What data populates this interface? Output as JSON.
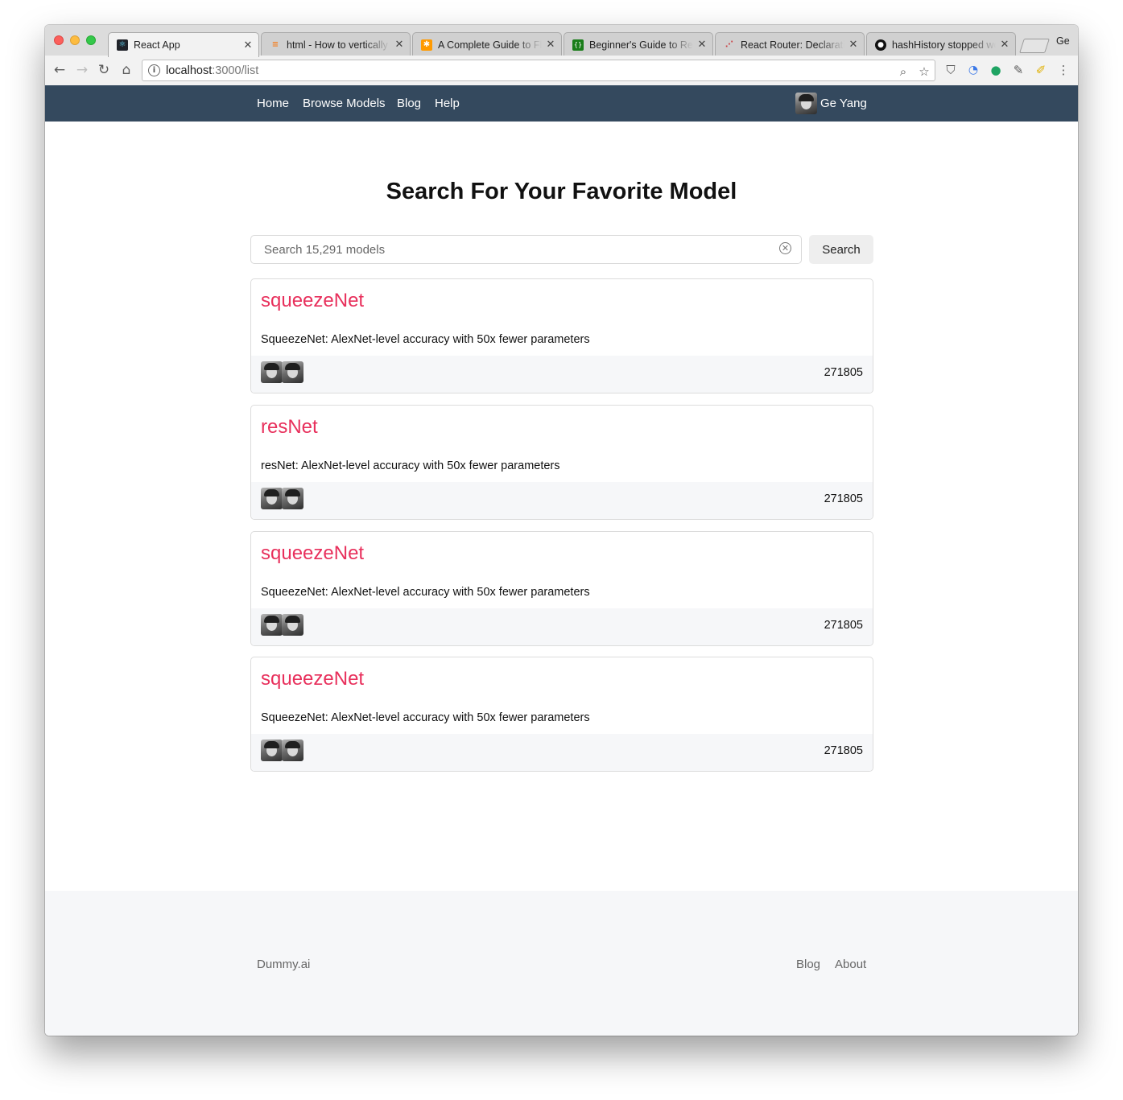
{
  "browser": {
    "tabs": [
      {
        "title": "React App",
        "favicon": "react-icon",
        "active": true
      },
      {
        "title": "html - How to vertically",
        "favicon": "stackoverflow-icon",
        "active": false
      },
      {
        "title": "A Complete Guide to Fle",
        "favicon": "css-tricks-icon",
        "active": false
      },
      {
        "title": "Beginner's Guide to Rea",
        "favicon": "code-icon",
        "active": false
      },
      {
        "title": "React Router: Declarati",
        "favicon": "react-router-icon",
        "active": false
      },
      {
        "title": "hashHistory stopped wo",
        "favicon": "github-icon",
        "active": false
      }
    ],
    "profile_label": "Ge",
    "url_host": "localhost",
    "url_path": ":3000/list"
  },
  "navbar": {
    "links": [
      "Home",
      "Browse Models",
      "Blog",
      "Help"
    ],
    "user_name": "Ge Yang"
  },
  "main": {
    "heading": "Search For Your Favorite Model",
    "search_placeholder": "Search 15,291 models",
    "search_button": "Search"
  },
  "models": [
    {
      "name": "squeezeNet",
      "description": "SqueezeNet: AlexNet-level accuracy with 50x fewer parameters",
      "count": "271805"
    },
    {
      "name": "resNet",
      "description": "resNet: AlexNet-level accuracy with 50x fewer parameters",
      "count": "271805"
    },
    {
      "name": "squeezeNet",
      "description": "SqueezeNet: AlexNet-level accuracy with 50x fewer parameters",
      "count": "271805"
    },
    {
      "name": "squeezeNet",
      "description": "SqueezeNet: AlexNet-level accuracy with 50x fewer parameters",
      "count": "271805"
    }
  ],
  "footer": {
    "brand": "Dummy.ai",
    "links": [
      "Blog",
      "About"
    ]
  },
  "colors": {
    "navbar": "#34495e",
    "model_title": "#e8305c",
    "footer_bg": "#f6f7f9"
  }
}
